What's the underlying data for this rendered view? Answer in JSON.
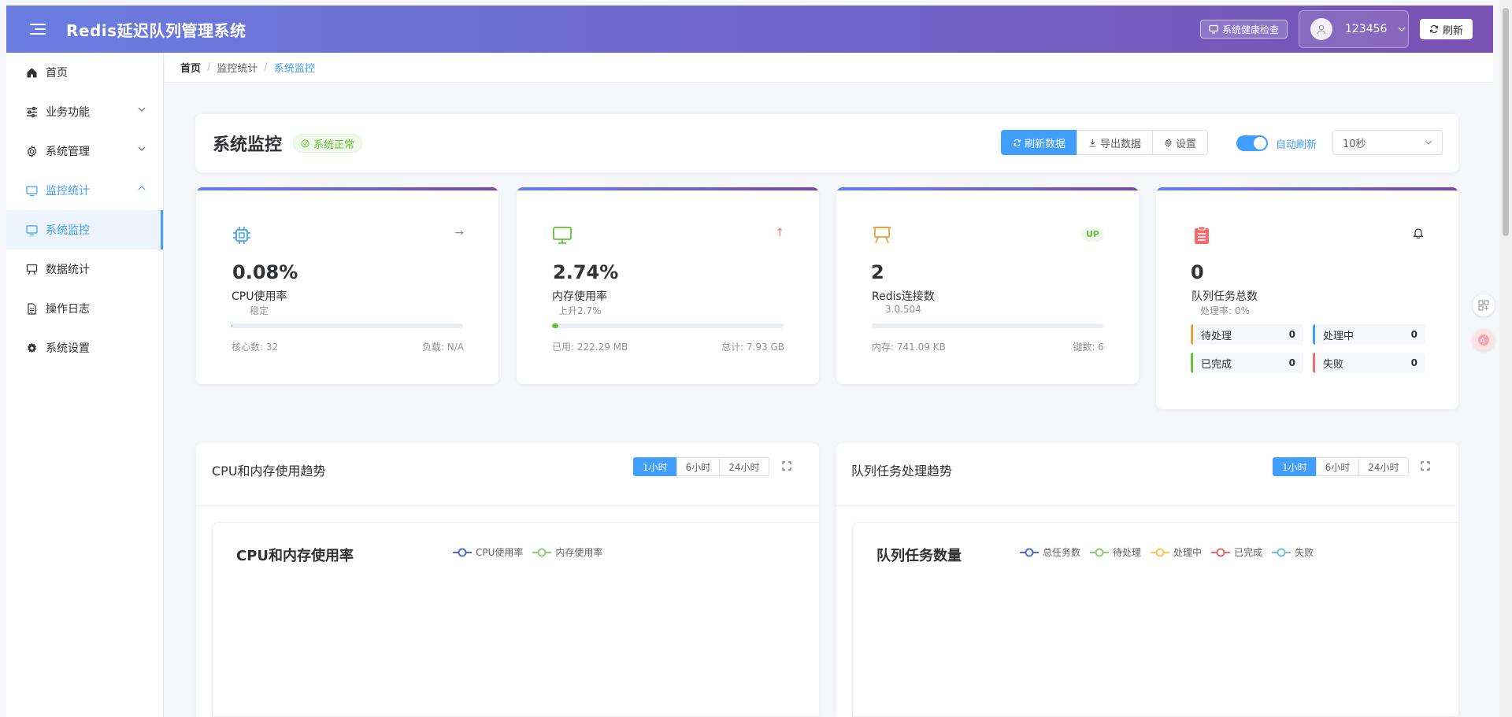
{
  "header": {
    "title": "Redis延迟队列管理系统",
    "health_check": "系统健康检查",
    "username": "123456",
    "refresh": "刷新"
  },
  "sidebar": {
    "items": [
      {
        "label": "首页"
      },
      {
        "label": "业务功能"
      },
      {
        "label": "系统管理"
      },
      {
        "label": "监控统计"
      },
      {
        "label": "系统监控"
      },
      {
        "label": "数据统计"
      },
      {
        "label": "操作日志"
      },
      {
        "label": "系统设置"
      }
    ]
  },
  "breadcrumb": [
    "首页",
    "监控统计",
    "系统监控"
  ],
  "page": {
    "title": "系统监控",
    "status": "系统正常",
    "buttons": {
      "refresh": "刷新数据",
      "export": "导出数据",
      "settings": "设置"
    },
    "auto_refresh_label": "自动刷新",
    "auto_refresh_on": true,
    "interval": "10秒"
  },
  "stats": {
    "cpu": {
      "value": "0.08%",
      "label": "CPU使用率",
      "sub": "稳定",
      "trend": "→",
      "progress": 0.0008,
      "foot_left": "核心数: 32",
      "foot_right": "负载: N/A"
    },
    "memory": {
      "value": "2.74%",
      "label": "内存使用率",
      "sub": "上升2.7%",
      "trend": "↑",
      "progress": 0.0274,
      "foot_left": "已用: 222.29 MB",
      "foot_right": "总计: 7.93 GB"
    },
    "redis": {
      "value": "2",
      "label": "Redis连接数",
      "sub": "3.0.504",
      "badge": "UP",
      "progress": 0,
      "foot_left": "内存: 741.09 KB",
      "foot_right": "键数: 6"
    },
    "queue": {
      "value": "0",
      "label": "队列任务总数",
      "sub": "处理率: 0%",
      "items": [
        {
          "label": "待处理",
          "count": "0",
          "color": "#e6a23c"
        },
        {
          "label": "处理中",
          "count": "0",
          "color": "#409eff"
        },
        {
          "label": "已完成",
          "count": "0",
          "color": "#67c23a"
        },
        {
          "label": "失败",
          "count": "0",
          "color": "#f56c6c"
        }
      ]
    }
  },
  "panels": {
    "cpu_mem": {
      "title": "CPU和内存使用趋势",
      "ranges": [
        "1小时",
        "6小时",
        "24小时"
      ],
      "chart_title": "CPU和内存使用率",
      "legend": [
        {
          "name": "CPU使用率",
          "color": "#5470c6"
        },
        {
          "name": "内存使用率",
          "color": "#91cc75"
        }
      ]
    },
    "queue": {
      "title": "队列任务处理趋势",
      "ranges": [
        "1小时",
        "6小时",
        "24小时"
      ],
      "chart_title": "队列任务数量",
      "legend": [
        {
          "name": "总任务数",
          "color": "#5470c6"
        },
        {
          "name": "待处理",
          "color": "#91cc75"
        },
        {
          "name": "处理中",
          "color": "#fac858"
        },
        {
          "name": "已完成",
          "color": "#ee6666"
        },
        {
          "name": "失败",
          "color": "#73c0de"
        }
      ]
    }
  }
}
